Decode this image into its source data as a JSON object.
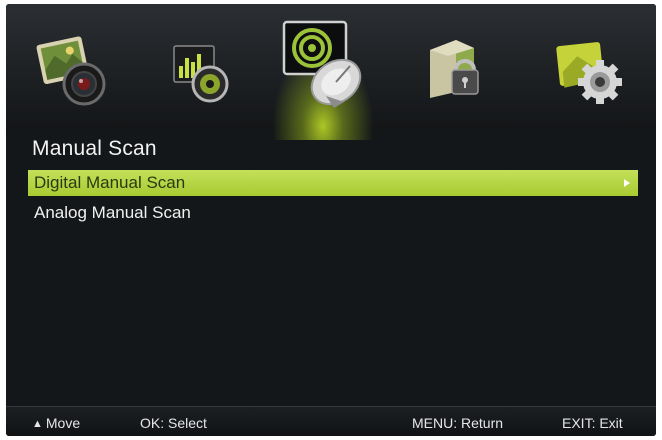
{
  "icons": [
    {
      "name": "picture-icon",
      "active": false
    },
    {
      "name": "sound-icon",
      "active": false
    },
    {
      "name": "channel-icon",
      "active": true
    },
    {
      "name": "lock-icon",
      "active": false
    },
    {
      "name": "setup-icon",
      "active": false
    }
  ],
  "header": {
    "title": "Manual Scan"
  },
  "menu": {
    "items": [
      {
        "label": "Digital Manual Scan",
        "selected": true
      },
      {
        "label": "Analog Manual Scan",
        "selected": false
      }
    ]
  },
  "footer": {
    "move_icon": "up-down-arrows",
    "move": "Move",
    "ok": "OK: Select",
    "menu": "MENU: Return",
    "exit": "EXIT: Exit"
  },
  "colors": {
    "accent": "#b4d43c",
    "background": "#141719"
  }
}
